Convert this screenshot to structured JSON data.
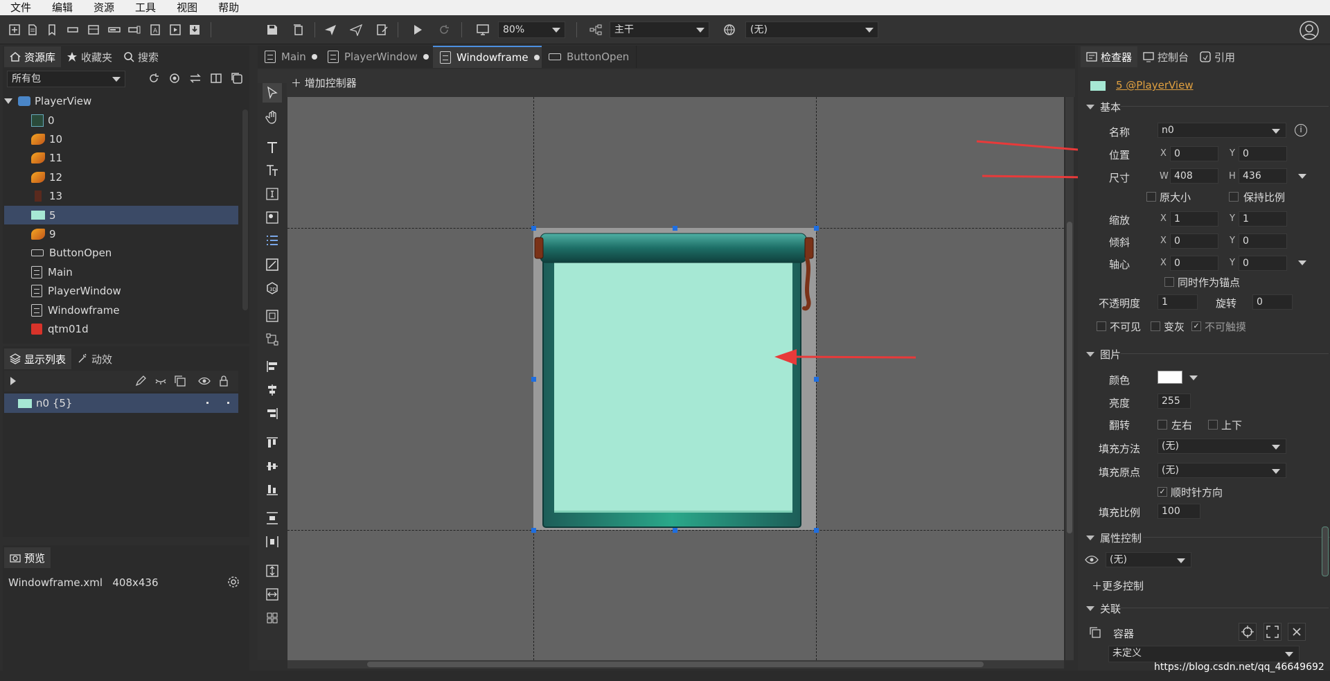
{
  "menu": [
    "文件",
    "编辑",
    "资源",
    "工具",
    "视图",
    "帮助"
  ],
  "toolbar": {
    "zoom": "80%",
    "branch": "主干",
    "language": "(无)"
  },
  "library": {
    "tabs": [
      "资源库",
      "收藏夹",
      "搜索"
    ],
    "package_filter": "所有包",
    "root": "PlayerView",
    "items": [
      {
        "label": "0",
        "icon": "image-thumb-icon"
      },
      {
        "label": "10",
        "icon": "fish-icon"
      },
      {
        "label": "11",
        "icon": "fish-icon"
      },
      {
        "label": "12",
        "icon": "fish-icon"
      },
      {
        "label": "13",
        "icon": "figure-icon"
      },
      {
        "label": "5",
        "icon": "image-swatch-icon"
      },
      {
        "label": "9",
        "icon": "fish-icon"
      },
      {
        "label": "ButtonOpen",
        "icon": "button-component-icon"
      },
      {
        "label": "Main",
        "icon": "document-icon"
      },
      {
        "label": "PlayerWindow",
        "icon": "document-icon"
      },
      {
        "label": "Windowframe",
        "icon": "document-icon"
      },
      {
        "label": "qtm01d",
        "icon": "flash-icon"
      }
    ]
  },
  "display_list": {
    "tabs": [
      "显示列表",
      "动效"
    ],
    "items": [
      {
        "label": "n0 {5}"
      }
    ]
  },
  "preview": {
    "tab": "预览",
    "file": "Windowframe.xml",
    "size": "408x436"
  },
  "doc_tabs": [
    {
      "label": "Main",
      "modified": true
    },
    {
      "label": "PlayerWindow",
      "modified": true
    },
    {
      "label": "Windowframe",
      "modified": true,
      "active": true
    },
    {
      "label": "ButtonOpen",
      "modified": false
    }
  ],
  "canvas": {
    "add_controller": "增加控制器"
  },
  "inspector": {
    "tabs": [
      "检查器",
      "控制台",
      "引用"
    ],
    "title": "5 @PlayerView",
    "sections": {
      "basic": "基本",
      "image": "图片",
      "property_control": "属性控制",
      "relation": "关联"
    },
    "name_label": "名称",
    "name_value": "n0",
    "position_label": "位置",
    "pos_x": "0",
    "pos_y": "0",
    "size_label": "尺寸",
    "size_w": "408",
    "size_h": "436",
    "original_size": "原大小",
    "keep_ratio": "保持比例",
    "scale_label": "缩放",
    "scale_x": "1",
    "scale_y": "1",
    "skew_label": "倾斜",
    "skew_x": "0",
    "skew_y": "0",
    "pivot_label": "轴心",
    "pivot_x": "0",
    "pivot_y": "0",
    "pivot_anchor": "同时作为锚点",
    "alpha_label": "不透明度",
    "alpha": "1",
    "rotation_label": "旋转",
    "rotation": "0",
    "invisible": "不可见",
    "grayed": "变灰",
    "untouchable": "不可触摸",
    "color_label": "颜色",
    "brightness_label": "亮度",
    "brightness": "255",
    "flip_label": "翻转",
    "flip_h": "左右",
    "flip_v": "上下",
    "fill_method_label": "填充方法",
    "fill_method": "(无)",
    "fill_origin_label": "填充原点",
    "fill_origin": "(无)",
    "clockwise": "顺时针方向",
    "fill_amount_label": "填充比例",
    "fill_amount": "100",
    "prop_control_value": "(无)",
    "more_controls": "更多控制",
    "container_label": "容器",
    "container_value": "未定义"
  },
  "axis": {
    "x": "X",
    "y": "Y",
    "w": "W",
    "h": "H"
  },
  "watermark": "https://blog.csdn.net/qq_46649692",
  "colors": {
    "accent": "#4c8fe0",
    "arrow": "#e83a3a",
    "swatch": "#a6e8d4",
    "selection": "#3b4a66"
  }
}
